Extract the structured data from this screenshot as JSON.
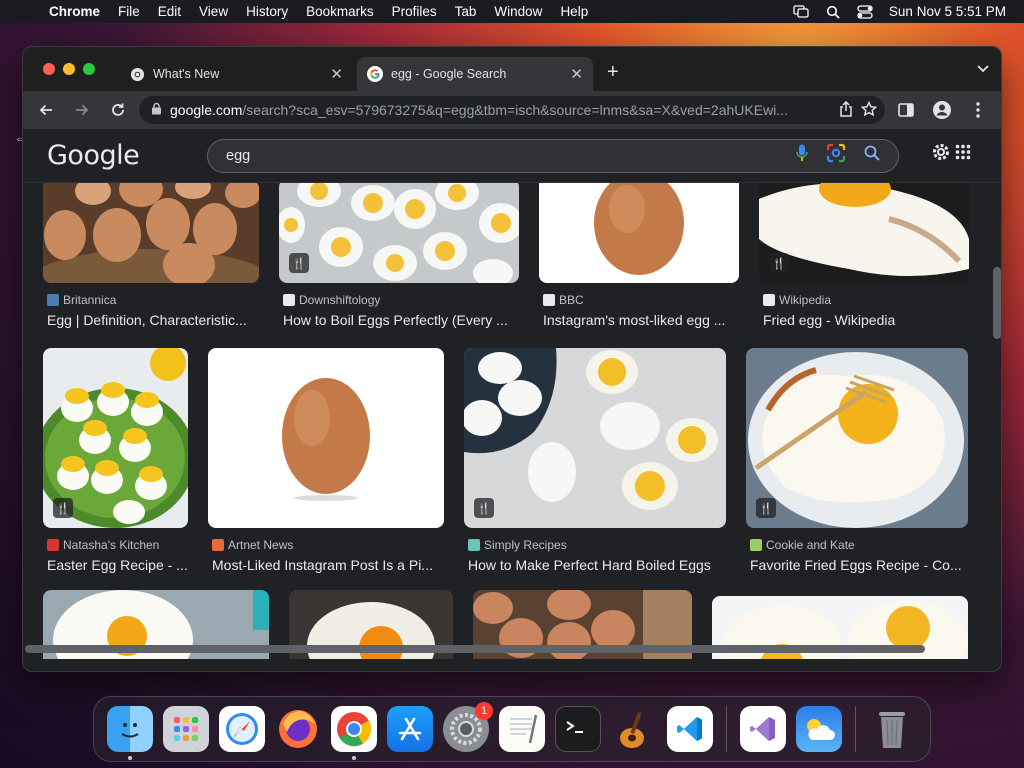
{
  "menubar": {
    "app": "Chrome",
    "menus": [
      "File",
      "Edit",
      "View",
      "History",
      "Bookmarks",
      "Profiles",
      "Tab",
      "Window",
      "Help"
    ],
    "clock": "Sun Nov 5  5:51 PM"
  },
  "tabs": [
    {
      "title": "What's New"
    },
    {
      "title": "egg - Google Search"
    }
  ],
  "toolbar": {
    "url_host": "google.com",
    "url_path": "/search?sca_esv=579673275&q=egg&tbm=isch&source=lnms&sa=X&ved=2ahUKEwi..."
  },
  "search": {
    "query": "egg"
  },
  "results": [
    {
      "source": "Britannica",
      "title": "Egg | Definition, Characteristic...",
      "recipe": false
    },
    {
      "source": "Downshiftology",
      "title": "How to Boil Eggs Perfectly (Every ...",
      "recipe": true
    },
    {
      "source": "BBC",
      "title": "Instagram's most-liked egg ...",
      "recipe": false
    },
    {
      "source": "Wikipedia",
      "title": "Fried egg - Wikipedia",
      "recipe": true
    },
    {
      "source": "Natasha's Kitchen",
      "title": "Easter Egg Recipe - ...",
      "recipe": true
    },
    {
      "source": "Artnet News",
      "title": "Most-Liked Instagram Post Is a Pi...",
      "recipe": false
    },
    {
      "source": "Simply Recipes",
      "title": "How to Make Perfect Hard Boiled Eggs",
      "recipe": true
    },
    {
      "source": "Cookie and Kate",
      "title": "Favorite Fried Eggs Recipe - Co...",
      "recipe": true
    }
  ],
  "dock": {
    "settings_badge": "1"
  },
  "colors": {
    "accent_blue": "#8ab4f8",
    "close_red": "#ff5f57",
    "minimize_yellow": "#febc2e",
    "zoom_green": "#28c840"
  }
}
